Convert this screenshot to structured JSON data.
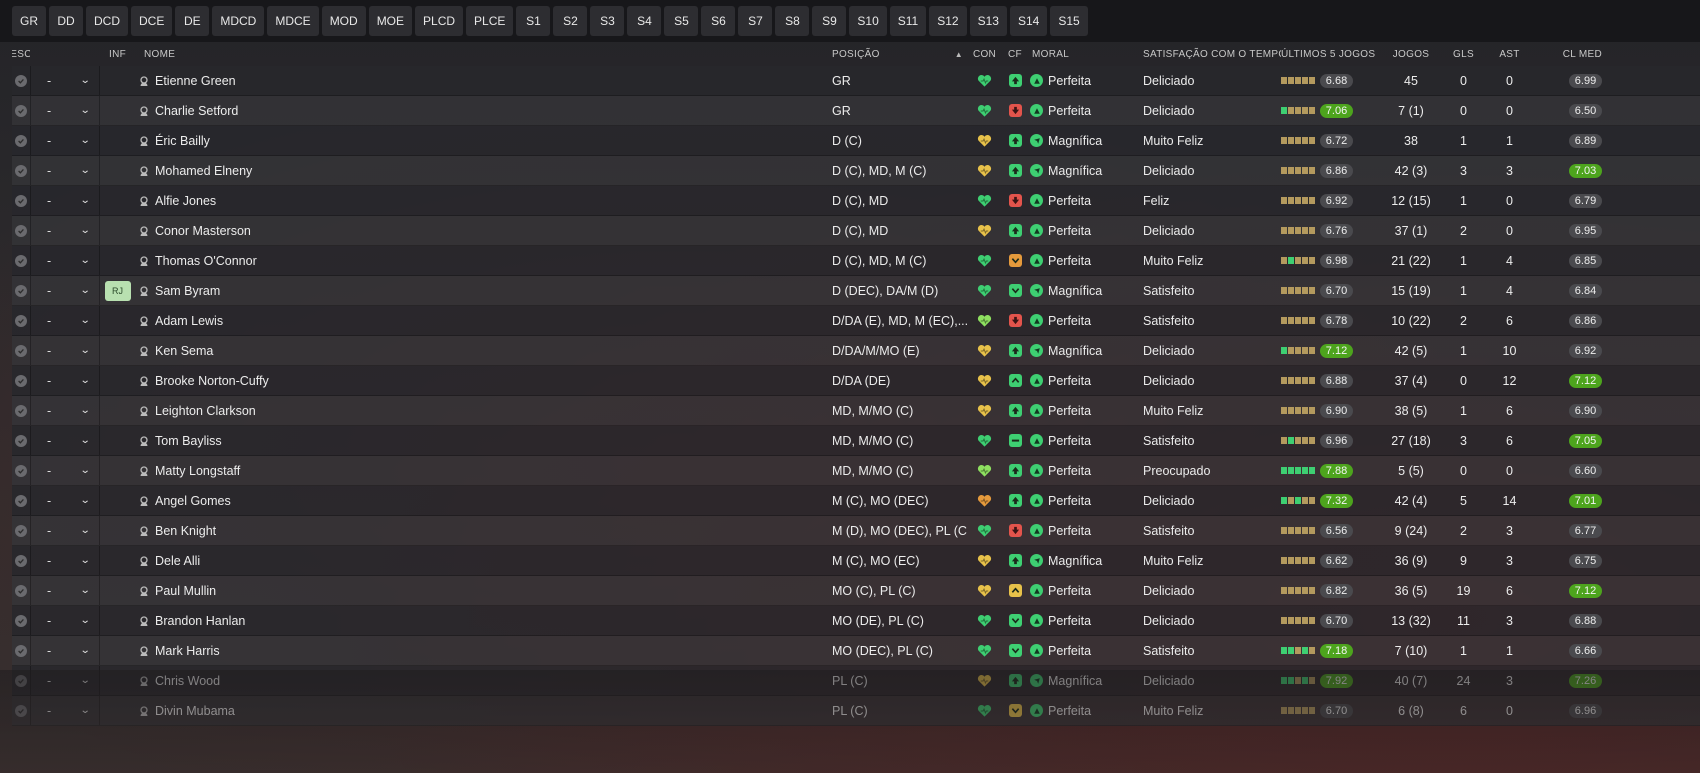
{
  "position_tabs": [
    "GR",
    "DD",
    "DCD",
    "DCE",
    "DE",
    "MDCD",
    "MDCE",
    "MOD",
    "MOE",
    "PLCD",
    "PLCE",
    "S1",
    "S2",
    "S3",
    "S4",
    "S5",
    "S6",
    "S7",
    "S8",
    "S9",
    "S10",
    "S11",
    "S12",
    "S13",
    "S14",
    "S15"
  ],
  "columns": {
    "esc": "ESC",
    "inf": "INF",
    "name": "NOME",
    "position": "POSIÇÃO",
    "con": "CON",
    "cf": "CF",
    "moral": "MORAL",
    "satisfaction": "SATISFAÇÃO COM O TEMPO...",
    "last5": "ÚLTIMOS 5 JOGOS",
    "games": "JOGOS",
    "goals": "GLS",
    "assists": "AST",
    "avg": "CL MED"
  },
  "sort_indicator": "▲",
  "colors": {
    "green": "#3ecf72",
    "light_green": "#8ee060",
    "red": "#e3544c",
    "orange": "#e59a3c",
    "amber": "#e8c24a",
    "highlight": "#4da41d",
    "form_dim": "#b49a5e"
  },
  "players": [
    {
      "esc": "-",
      "inf": "",
      "name": "Etienne Green",
      "pos": "GR",
      "con": "green",
      "cf": "up",
      "moral": "Perfeita",
      "sat": "Deliciado",
      "form": [
        "o",
        "o",
        "o",
        "o",
        "o"
      ],
      "rating": "6.68",
      "rating_hi": false,
      "games": "45",
      "gls": "0",
      "ast": "0",
      "avg": "6.99",
      "avg_hi": false
    },
    {
      "esc": "-",
      "inf": "",
      "name": "Charlie Setford",
      "pos": "GR",
      "con": "green",
      "cf": "down",
      "moral": "Perfeita",
      "sat": "Deliciado",
      "form": [
        "g",
        "o",
        "o",
        "o",
        "o"
      ],
      "rating": "7.06",
      "rating_hi": true,
      "games": "7 (1)",
      "gls": "0",
      "ast": "0",
      "avg": "6.50",
      "avg_hi": false
    },
    {
      "esc": "-",
      "inf": "",
      "name": "Éric Bailly",
      "pos": "D (C)",
      "con": "amber",
      "cf": "up",
      "moral": "Magnífica",
      "sat": "Muito Feliz",
      "form": [
        "o",
        "o",
        "o",
        "o",
        "o"
      ],
      "rating": "6.72",
      "rating_hi": false,
      "games": "38",
      "gls": "1",
      "ast": "1",
      "avg": "6.89",
      "avg_hi": false
    },
    {
      "esc": "-",
      "inf": "",
      "name": "Mohamed Elneny",
      "pos": "D (C), MD, M (C)",
      "con": "amber",
      "cf": "up",
      "moral": "Magnífica",
      "sat": "Deliciado",
      "form": [
        "o",
        "o",
        "o",
        "o",
        "o"
      ],
      "rating": "6.86",
      "rating_hi": false,
      "games": "42 (3)",
      "gls": "3",
      "ast": "3",
      "avg": "7.03",
      "avg_hi": true
    },
    {
      "esc": "-",
      "inf": "",
      "name": "Alfie Jones",
      "pos": "D (C), MD",
      "con": "green",
      "cf": "down",
      "moral": "Perfeita",
      "sat": "Feliz",
      "form": [
        "o",
        "o",
        "o",
        "o",
        "o"
      ],
      "rating": "6.92",
      "rating_hi": false,
      "games": "12 (15)",
      "gls": "1",
      "ast": "0",
      "avg": "6.79",
      "avg_hi": false
    },
    {
      "esc": "-",
      "inf": "",
      "name": "Conor Masterson",
      "pos": "D (C), MD",
      "con": "amber",
      "cf": "up",
      "moral": "Perfeita",
      "sat": "Deliciado",
      "form": [
        "o",
        "o",
        "o",
        "o",
        "o"
      ],
      "rating": "6.76",
      "rating_hi": false,
      "games": "37 (1)",
      "gls": "2",
      "ast": "0",
      "avg": "6.95",
      "avg_hi": false
    },
    {
      "esc": "-",
      "inf": "",
      "name": "Thomas O'Connor",
      "pos": "D (C), MD, M (C)",
      "con": "green",
      "cf": "downorange",
      "moral": "Perfeita",
      "sat": "Muito Feliz",
      "form": [
        "o",
        "g",
        "o",
        "o",
        "o"
      ],
      "rating": "6.98",
      "rating_hi": false,
      "games": "21 (22)",
      "gls": "1",
      "ast": "4",
      "avg": "6.85",
      "avg_hi": false
    },
    {
      "esc": "-",
      "inf": "RJ",
      "name": "Sam Byram",
      "pos": "D (DEC), DA/M (D)",
      "con": "green",
      "cf": "downgreen",
      "moral": "Magnífica",
      "sat": "Satisfeito",
      "form": [
        "o",
        "o",
        "o",
        "o",
        "o"
      ],
      "rating": "6.70",
      "rating_hi": false,
      "games": "15 (19)",
      "gls": "1",
      "ast": "4",
      "avg": "6.84",
      "avg_hi": false
    },
    {
      "esc": "-",
      "inf": "",
      "name": "Adam Lewis",
      "pos": "D/DA (E), MD, M (EC),...",
      "con": "lightgreen",
      "cf": "down",
      "moral": "Perfeita",
      "sat": "Satisfeito",
      "form": [
        "o",
        "o",
        "o",
        "o",
        "o"
      ],
      "rating": "6.78",
      "rating_hi": false,
      "games": "10 (22)",
      "gls": "2",
      "ast": "6",
      "avg": "6.86",
      "avg_hi": false
    },
    {
      "esc": "-",
      "inf": "",
      "name": "Ken Sema",
      "pos": "D/DA/M/MO (E)",
      "con": "amber",
      "cf": "up",
      "moral": "Magnífica",
      "sat": "Deliciado",
      "form": [
        "g",
        "o",
        "o",
        "o",
        "o"
      ],
      "rating": "7.12",
      "rating_hi": true,
      "games": "42 (5)",
      "gls": "1",
      "ast": "10",
      "avg": "6.92",
      "avg_hi": false
    },
    {
      "esc": "-",
      "inf": "",
      "name": "Brooke Norton-Cuffy",
      "pos": "D/DA (DE)",
      "con": "amber",
      "cf": "upgreen",
      "moral": "Perfeita",
      "sat": "Deliciado",
      "form": [
        "o",
        "o",
        "o",
        "o",
        "o"
      ],
      "rating": "6.88",
      "rating_hi": false,
      "games": "37 (4)",
      "gls": "0",
      "ast": "12",
      "avg": "7.12",
      "avg_hi": true
    },
    {
      "esc": "-",
      "inf": "",
      "name": "Leighton Clarkson",
      "pos": "MD, M/MO (C)",
      "con": "amber",
      "cf": "up",
      "moral": "Perfeita",
      "sat": "Muito Feliz",
      "form": [
        "o",
        "o",
        "o",
        "o",
        "o"
      ],
      "rating": "6.90",
      "rating_hi": false,
      "games": "38 (5)",
      "gls": "1",
      "ast": "6",
      "avg": "6.90",
      "avg_hi": false
    },
    {
      "esc": "-",
      "inf": "",
      "name": "Tom Bayliss",
      "pos": "MD, M/MO (C)",
      "con": "green",
      "cf": "flat",
      "moral": "Perfeita",
      "sat": "Satisfeito",
      "form": [
        "o",
        "g",
        "o",
        "o",
        "o"
      ],
      "rating": "6.96",
      "rating_hi": false,
      "games": "27 (18)",
      "gls": "3",
      "ast": "6",
      "avg": "7.05",
      "avg_hi": true
    },
    {
      "esc": "-",
      "inf": "",
      "name": "Matty Longstaff",
      "pos": "MD, M/MO (C)",
      "con": "lightgreen",
      "cf": "up",
      "moral": "Perfeita",
      "sat": "Preocupado",
      "form": [
        "g",
        "g",
        "g",
        "g",
        "g"
      ],
      "rating": "7.88",
      "rating_hi": true,
      "games": "5 (5)",
      "gls": "0",
      "ast": "0",
      "avg": "6.60",
      "avg_hi": false
    },
    {
      "esc": "-",
      "inf": "",
      "name": "Angel Gomes",
      "pos": "M (C), MO (DEC)",
      "con": "orange",
      "cf": "up",
      "moral": "Perfeita",
      "sat": "Deliciado",
      "form": [
        "g",
        "o",
        "g",
        "o",
        "o"
      ],
      "rating": "7.32",
      "rating_hi": true,
      "games": "42 (4)",
      "gls": "5",
      "ast": "14",
      "avg": "7.01",
      "avg_hi": true
    },
    {
      "esc": "-",
      "inf": "",
      "name": "Ben Knight",
      "pos": "M (D), MO (DEC), PL (C)",
      "con": "green",
      "cf": "down",
      "moral": "Perfeita",
      "sat": "Satisfeito",
      "form": [
        "o",
        "o",
        "o",
        "o",
        "o"
      ],
      "rating": "6.56",
      "rating_hi": false,
      "games": "9 (24)",
      "gls": "2",
      "ast": "3",
      "avg": "6.77",
      "avg_hi": false
    },
    {
      "esc": "-",
      "inf": "",
      "name": "Dele Alli",
      "pos": "M (C), MO (EC)",
      "con": "amber",
      "cf": "up",
      "moral": "Magnífica",
      "sat": "Muito Feliz",
      "form": [
        "o",
        "o",
        "o",
        "o",
        "o"
      ],
      "rating": "6.62",
      "rating_hi": false,
      "games": "36 (9)",
      "gls": "9",
      "ast": "3",
      "avg": "6.75",
      "avg_hi": false
    },
    {
      "esc": "-",
      "inf": "",
      "name": "Paul Mullin",
      "pos": "MO (C), PL (C)",
      "con": "yellow",
      "cf": "upamber",
      "moral": "Perfeita",
      "sat": "Deliciado",
      "form": [
        "o",
        "o",
        "o",
        "o",
        "o"
      ],
      "rating": "6.82",
      "rating_hi": false,
      "games": "36 (5)",
      "gls": "19",
      "ast": "6",
      "avg": "7.12",
      "avg_hi": true
    },
    {
      "esc": "-",
      "inf": "",
      "name": "Brandon Hanlan",
      "pos": "MO (DE), PL (C)",
      "con": "green",
      "cf": "downgreen",
      "moral": "Perfeita",
      "sat": "Deliciado",
      "form": [
        "o",
        "o",
        "o",
        "o",
        "o"
      ],
      "rating": "6.70",
      "rating_hi": false,
      "games": "13 (32)",
      "gls": "11",
      "ast": "3",
      "avg": "6.88",
      "avg_hi": false
    },
    {
      "esc": "-",
      "inf": "",
      "name": "Mark Harris",
      "pos": "MO (DEC), PL (C)",
      "con": "green",
      "cf": "downgreen",
      "moral": "Perfeita",
      "sat": "Satisfeito",
      "form": [
        "g",
        "g",
        "o",
        "g",
        "o"
      ],
      "rating": "7.18",
      "rating_hi": true,
      "games": "7 (10)",
      "gls": "1",
      "ast": "1",
      "avg": "6.66",
      "avg_hi": false
    },
    {
      "esc": "-",
      "inf": "",
      "name": "Chris Wood",
      "pos": "PL (C)",
      "con": "amber",
      "cf": "up",
      "moral": "Magnífica",
      "sat": "Deliciado",
      "form": [
        "g",
        "g",
        "o",
        "g",
        "o"
      ],
      "rating": "7.92",
      "rating_hi": true,
      "games": "40 (7)",
      "gls": "24",
      "ast": "3",
      "avg": "7.26",
      "avg_hi": true
    },
    {
      "esc": "-",
      "inf": "",
      "name": "Divin Mubama",
      "pos": "PL (C)",
      "con": "green",
      "cf": "downamber",
      "moral": "Perfeita",
      "sat": "Muito Feliz",
      "form": [
        "o",
        "o",
        "o",
        "o",
        "o"
      ],
      "rating": "6.70",
      "rating_hi": false,
      "games": "6 (8)",
      "gls": "6",
      "ast": "0",
      "avg": "6.96",
      "avg_hi": false
    }
  ]
}
